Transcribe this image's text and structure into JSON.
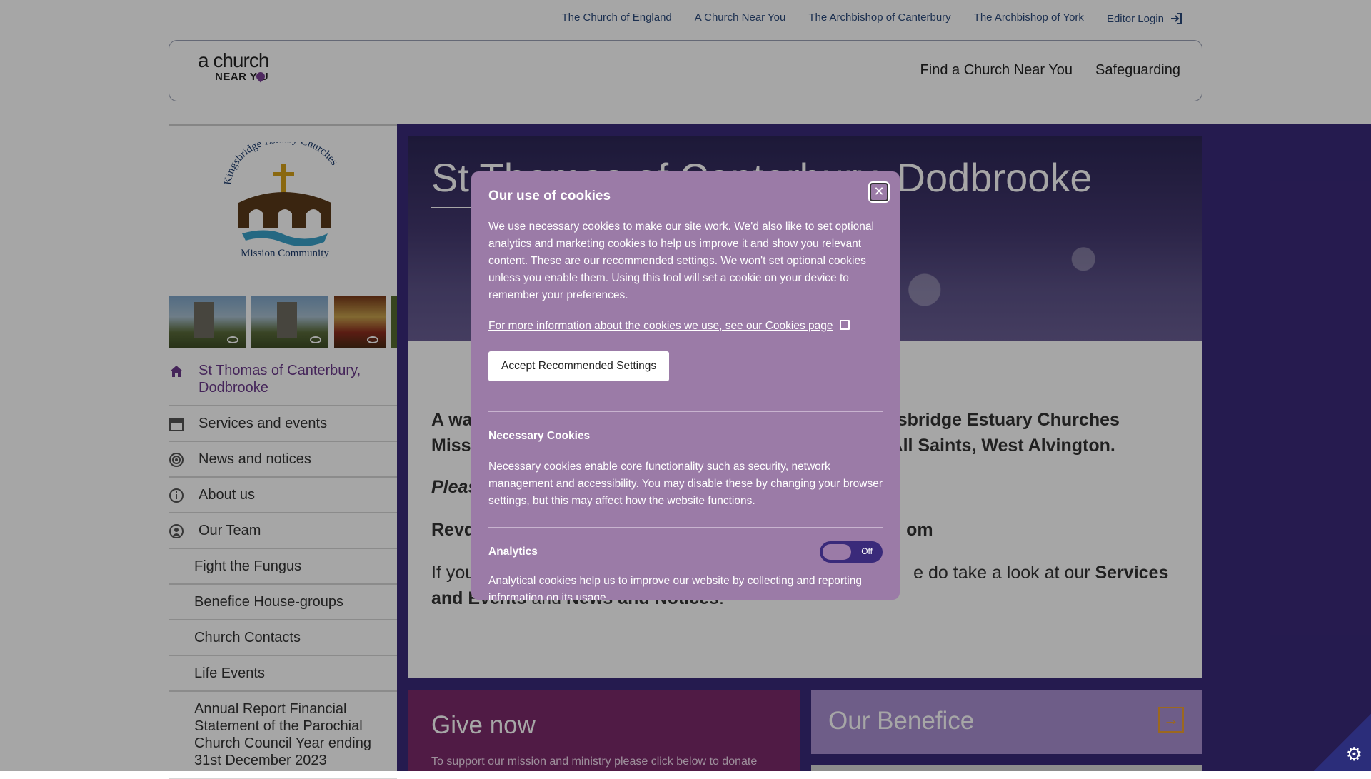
{
  "utility_nav": {
    "links": [
      "The Church of England",
      "A Church Near You",
      "The Archbishop of Canterbury",
      "The Archbishop of York"
    ],
    "editor_login": "Editor Login"
  },
  "header": {
    "logo_line1": "a church",
    "logo_line2": "NEAR Y U",
    "nav": [
      "Find a Church Near You",
      "Safeguarding"
    ]
  },
  "sidebar": {
    "badge_top": "Kingsbridge Estuary Churches",
    "badge_bottom": "Mission Community",
    "menu": [
      {
        "label": "St Thomas of Canterbury, Dodbrooke",
        "icon": "home-icon"
      },
      {
        "label": "Services and events",
        "icon": "calendar-icon"
      },
      {
        "label": "News and notices",
        "icon": "broadcast-icon"
      },
      {
        "label": "About us",
        "icon": "info-icon"
      },
      {
        "label": "Our Team",
        "icon": "person-icon"
      }
    ],
    "submenu": [
      "Fight the Fungus",
      "Benefice House-groups",
      "Church Contacts",
      "Life Events",
      "Annual Report Financial Statement of the Parochial Church Council Year ending 31st December 2023"
    ]
  },
  "hero": {
    "title": "St Thomas of Canterbury, Dodbrooke"
  },
  "content": {
    "welcome_start": "A wa",
    "welcome_end": "gsbridge Estuary Churches",
    "welcome_line2_start": "Missi",
    "welcome_line2_end": "All Saints, West Alvington.",
    "please": "Pleas",
    "revd_start": "Revd",
    "revd_end": "om",
    "if_start": "If you",
    "if_end": "e do take a look at our",
    "services_bold": "Services",
    "and_events": "and Events",
    "and": "and",
    "news_bold": "News and Notices",
    "period": "."
  },
  "give": {
    "title": "Give now",
    "text": "To support our mission and ministry please click below to donate"
  },
  "benefice": {
    "title": "Our Benefice"
  },
  "cookie_modal": {
    "title": "Our use of cookies",
    "intro": "We use necessary cookies to make our site work. We'd also like to set optional analytics and marketing cookies to help us improve it and show you relevant content. These are our recommended settings. We won't set optional cookies unless you enable them. Using this tool will set a cookie on your device to remember your preferences.",
    "more_info": "For more information about the cookies we use, see our Cookies page",
    "accept_button": "Accept Recommended Settings",
    "necessary_heading": "Necessary Cookies",
    "necessary_text": "Necessary cookies enable core functionality such as security, network management and accessibility. You may disable these by changing your browser settings, but this may affect how the website functions.",
    "analytics_heading": "Analytics",
    "analytics_toggle": "Off",
    "analytics_text": "Analytical cookies help us to improve our website by collecting and reporting information on its usage."
  },
  "colors": {
    "accent_purple": "#6b3a8a",
    "modal_bg": "#9b7ba7",
    "main_bg": "#3a2a7a",
    "give_bg": "#7b2a6b",
    "benefice_bg": "#a98fd2"
  }
}
